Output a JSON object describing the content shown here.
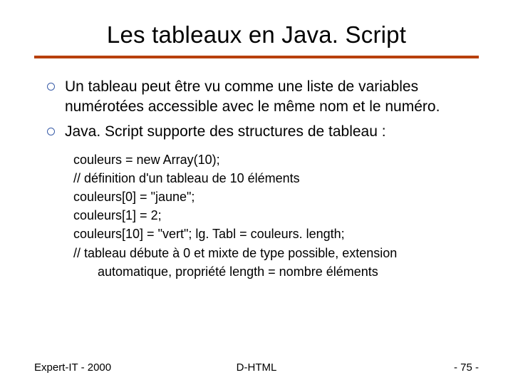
{
  "title": "Les tableaux en Java. Script",
  "bullets": [
    "Un tableau peut être vu comme une liste de variables numérotées accessible avec le même nom et le numéro.",
    "Java. Script supporte des structures de tableau :"
  ],
  "code": {
    "l0": "couleurs = new Array(10);",
    "l1": "// définition d'un tableau de 10 éléments",
    "l2": "couleurs[0] = \"jaune\";",
    "l3": "couleurs[1] = 2;",
    "l4": "couleurs[10] = \"vert\"; lg. Tabl = couleurs. length;",
    "l5": "// tableau débute à 0 et mixte de type possible, extension",
    "l5b": "automatique, propriété length = nombre éléments"
  },
  "footer": {
    "left": "Expert-IT - 2000",
    "center": "D-HTML",
    "right": "- 75 -"
  }
}
